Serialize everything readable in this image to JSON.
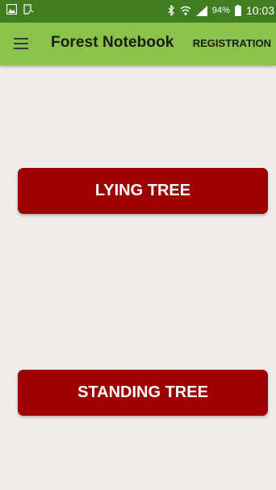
{
  "status_bar": {
    "battery": "94%",
    "time": "10:03",
    "icons": [
      "image-icon",
      "notification-icon",
      "bluetooth-icon",
      "wifi-icon",
      "signal-icon",
      "battery-icon"
    ]
  },
  "app_bar": {
    "title": "Forest Notebook",
    "action": "REGISTRATION",
    "background": "#8bc34a"
  },
  "buttons": {
    "lying_tree": "LYING TREE",
    "standing_tree": "STANDING TREE",
    "color": "#9c0000"
  }
}
